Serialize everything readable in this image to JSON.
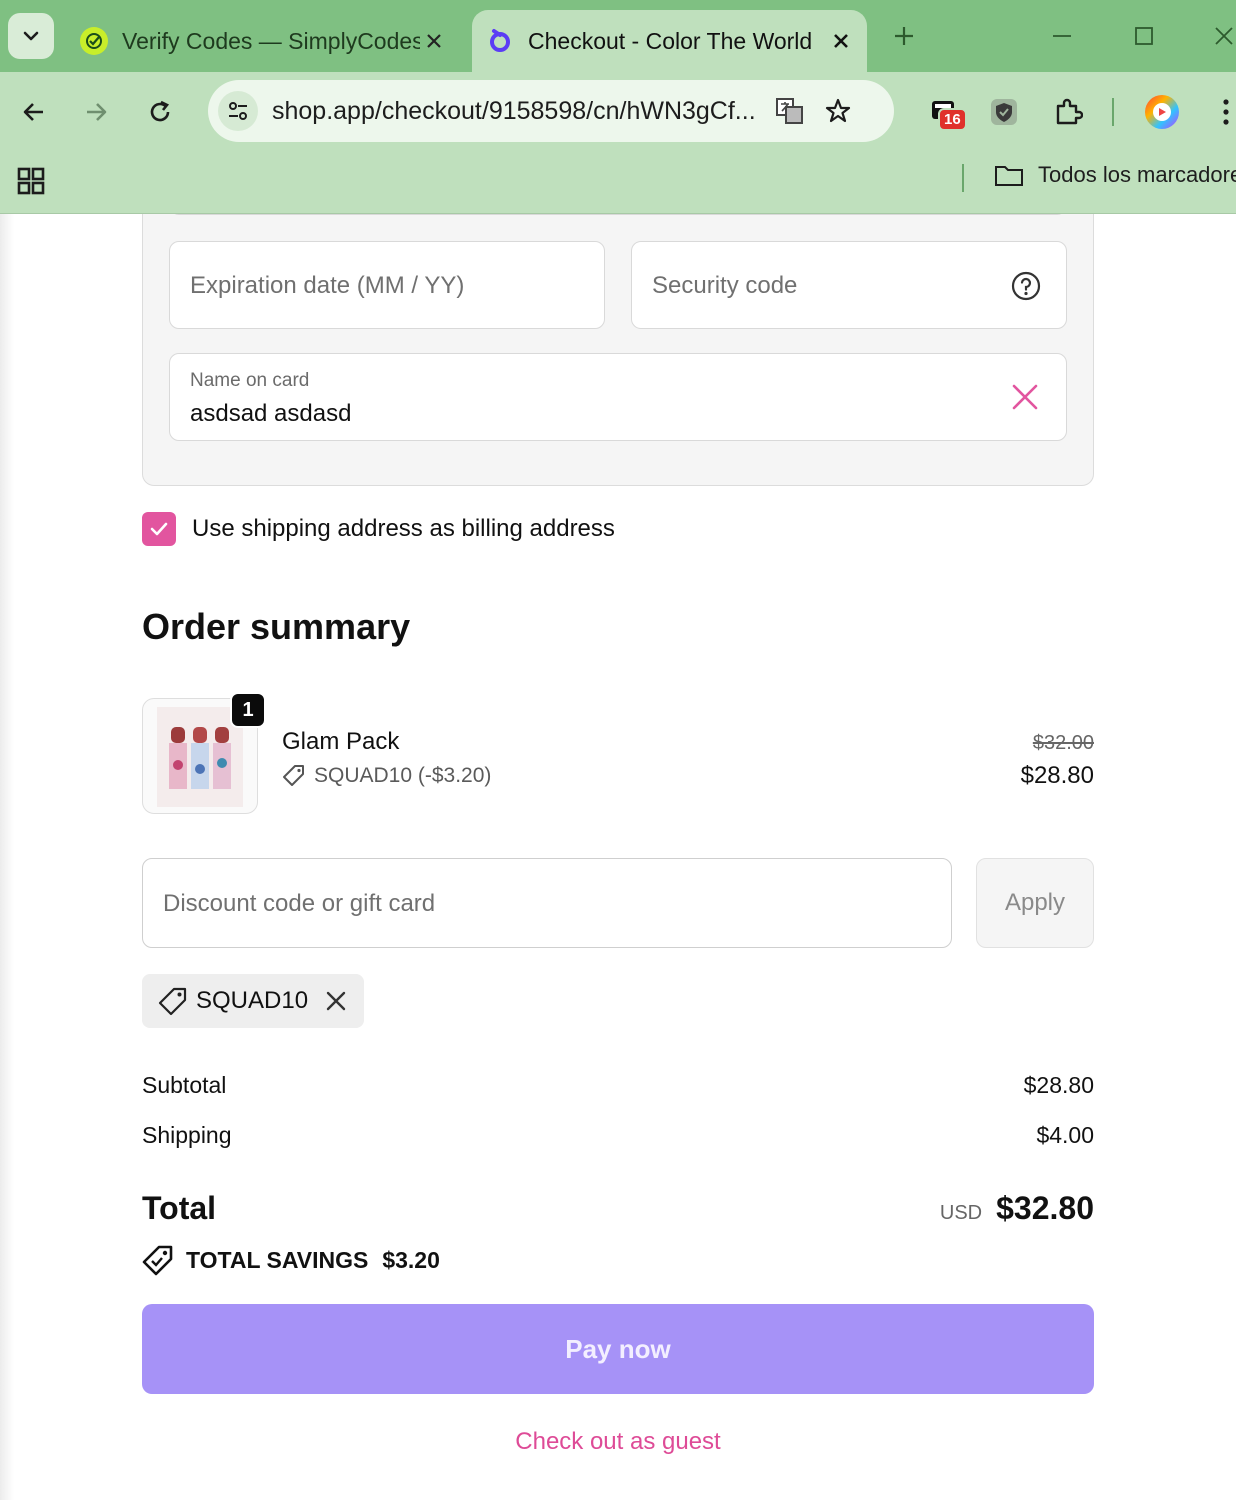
{
  "browser": {
    "tabs": [
      {
        "title": "Verify Codes — SimplyCodes",
        "active": false
      },
      {
        "title": "Checkout - Color The World",
        "active": true
      }
    ],
    "url": "shop.app/checkout/9158598/cn/hWN3gCf...",
    "extension_badge": "16",
    "bookmarks_all_label": "Todos los marcadores",
    "colors": {
      "frame": "#7fc082",
      "toolbar": "#bfe0bd"
    }
  },
  "payment": {
    "expiration_placeholder": "Expiration date (MM / YY)",
    "security_placeholder": "Security code",
    "name_label": "Name on card",
    "name_value": "asdsad asdasd",
    "billing_checkbox_label": "Use shipping address as billing address",
    "billing_checked": true
  },
  "order": {
    "title": "Order summary",
    "items": [
      {
        "quantity": "1",
        "name": "Glam Pack",
        "discount": "SQUAD10 (-$3.20)",
        "original_price": "$32.00",
        "price": "$28.80"
      }
    ],
    "discount_placeholder": "Discount code or gift card",
    "apply_label": "Apply",
    "applied_code": "SQUAD10",
    "subtotal_label": "Subtotal",
    "subtotal_value": "$28.80",
    "shipping_label": "Shipping",
    "shipping_value": "$4.00",
    "total_label": "Total",
    "currency": "USD",
    "total_value": "$32.80",
    "savings_label": "TOTAL SAVINGS",
    "savings_value": "$3.20",
    "pay_label": "Pay now",
    "guest_label": "Check out as guest"
  },
  "colors": {
    "accent_pink": "#e2559f",
    "pay_button": "#a692f7"
  }
}
